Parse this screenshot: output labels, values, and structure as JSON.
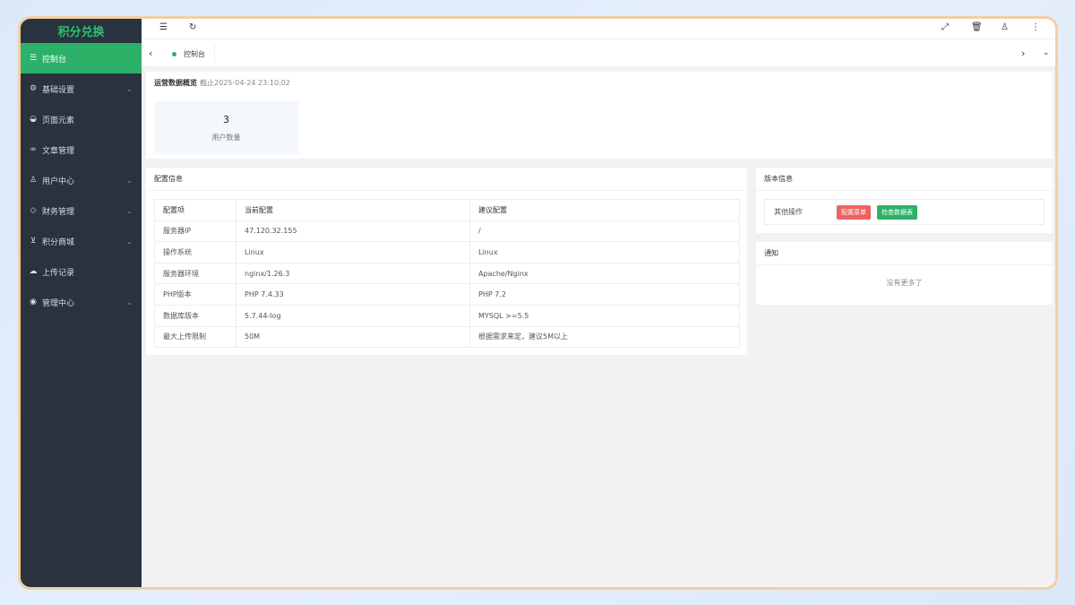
{
  "brand": "积分兑换",
  "sidebar": {
    "items": [
      {
        "label": "控制台",
        "icon": "sliders-icon",
        "glyph": "☰",
        "active": true,
        "chevron": false
      },
      {
        "label": "基础设置",
        "icon": "gear-icon",
        "glyph": "⚙",
        "active": false,
        "chevron": true
      },
      {
        "label": "页面元素",
        "icon": "palette-icon",
        "glyph": "◒",
        "active": false,
        "chevron": false
      },
      {
        "label": "文章管理",
        "icon": "link-icon",
        "glyph": "∞",
        "active": false,
        "chevron": false
      },
      {
        "label": "用户中心",
        "icon": "user-icon",
        "glyph": "♙",
        "active": false,
        "chevron": true
      },
      {
        "label": "财务管理",
        "icon": "shield-icon",
        "glyph": "◇",
        "active": false,
        "chevron": true
      },
      {
        "label": "积分商城",
        "icon": "cart-icon",
        "glyph": "⊻",
        "active": false,
        "chevron": true
      },
      {
        "label": "上传记录",
        "icon": "cloud-upload-icon",
        "glyph": "☁",
        "active": false,
        "chevron": false
      },
      {
        "label": "管理中心",
        "icon": "target-icon",
        "glyph": "◉",
        "active": false,
        "chevron": true
      }
    ]
  },
  "tabs": [
    {
      "label": "控制台"
    }
  ],
  "overview": {
    "title": "运营数据概览",
    "subtitle": "截止2025-04-24 23:10:02",
    "stat_value": "3",
    "stat_label": "用户数量"
  },
  "config": {
    "title": "配置信息",
    "headers": [
      "配置项",
      "当前配置",
      "建议配置"
    ],
    "rows": [
      [
        "服务器IP",
        "47.120.32.155",
        "/"
      ],
      [
        "操作系统",
        "Linux",
        "Linux"
      ],
      [
        "服务器环境",
        "nginx/1.26.3",
        "Apache/Nginx"
      ],
      [
        "PHP版本",
        "PHP 7.4.33",
        "PHP 7.2"
      ],
      [
        "数据库版本",
        "5.7.44-log",
        "MYSQL >=5.5"
      ],
      [
        "最大上传限制",
        "50M",
        "根据需求来定，建议5M以上"
      ]
    ]
  },
  "version": {
    "title": "版本信息",
    "other_ops_label": "其他操作",
    "btn_config_menu": "配置菜单",
    "btn_check_db": "检查数据表"
  },
  "notice": {
    "title": "通知",
    "empty": "没有更多了"
  },
  "colors": {
    "accent": "#2db168",
    "sidebar_bg": "#28333e",
    "danger": "#f06262",
    "frame_border": "#f3cfa4"
  }
}
